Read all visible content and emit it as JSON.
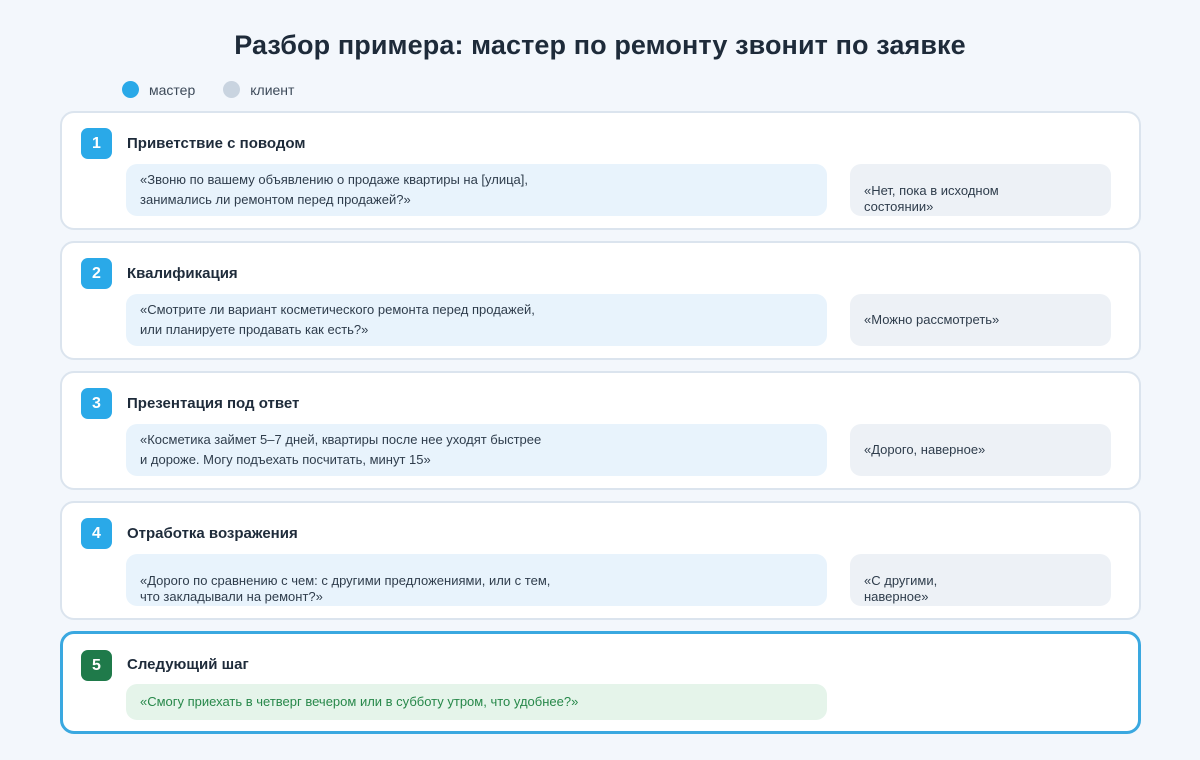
{
  "title": "Разбор примера: мастер по ремонту звонит по заявке",
  "legend": [
    {
      "label": "мастер",
      "color": "#2aa9e8"
    },
    {
      "label": "клиент",
      "color": "#c9d4e0"
    }
  ],
  "colors": {
    "step_badge": "#2aa9e8",
    "final_badge": "#1f7a4a",
    "final_border": "#3aa8e0",
    "master_bubble": "#e8f3fc",
    "client_bubble": "#edf1f6",
    "next_bubble": "#e5f4ea",
    "next_text": "#27884a"
  },
  "steps": [
    {
      "number": "1",
      "title": "Приветствие с поводом",
      "master": "«Звоню по вашему объявлению о продаже квартиры на [улица],\nзанимались ли ремонтом перед продажей?»",
      "client": "«Нет, пока в исходном\nсостоянии»"
    },
    {
      "number": "2",
      "title": "Квалификация",
      "master": "«Смотрите ли вариант косметического ремонта перед продажей,\nили планируете продавать как есть?»",
      "client": "«Можно рассмотреть»"
    },
    {
      "number": "3",
      "title": "Презентация под ответ",
      "master": "«Косметика займет 5–7 дней, квартиры после нее уходят быстрее\nи дороже. Могу подъехать посчитать, минут 15»",
      "client": "«Дорого, наверное»"
    },
    {
      "number": "4",
      "title": "Отработка возражения",
      "master": "«Дорого по сравнению с чем: с другими предложениями, или с тем,\nчто закладывали на ремонт?»",
      "client": "«С другими,\nнаверное»"
    }
  ],
  "final_step": {
    "number": "5",
    "title": "Следующий шаг",
    "master": "«Смогу приехать в четверг вечером или в субботу утром, что удобнее?»"
  }
}
